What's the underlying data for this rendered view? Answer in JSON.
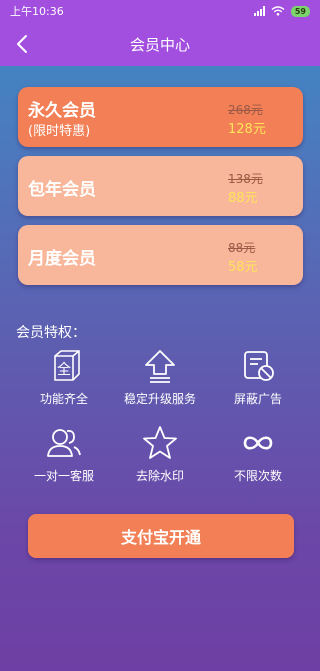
{
  "status": {
    "time": "上午10:36",
    "battery": "59"
  },
  "header": {
    "title": "会员中心"
  },
  "plans": [
    {
      "name": "永久会员",
      "subtitle": "(限时特惠)",
      "old_price": "268元",
      "price": "128元"
    },
    {
      "name": "包年会员",
      "old_price": "138元",
      "price": "88元"
    },
    {
      "name": "月度会员",
      "old_price": "88元",
      "price": "58元"
    }
  ],
  "perks": {
    "title": "会员特权：",
    "items": [
      {
        "label": "功能齐全",
        "icon": "full-features-icon"
      },
      {
        "label": "稳定升级服务",
        "icon": "upgrade-arrow-icon"
      },
      {
        "label": "屏蔽广告",
        "icon": "block-ads-icon"
      },
      {
        "label": "一对一客服",
        "icon": "customer-service-icon"
      },
      {
        "label": "去除水印",
        "icon": "star-icon"
      },
      {
        "label": "不限次数",
        "icon": "infinity-icon"
      }
    ]
  },
  "pay_button": {
    "label": "支付宝开通"
  },
  "colors": {
    "header": "#a24fe0",
    "accent": "#f27f55",
    "card_light": "#f8b79a",
    "price": "#ffe45a"
  }
}
